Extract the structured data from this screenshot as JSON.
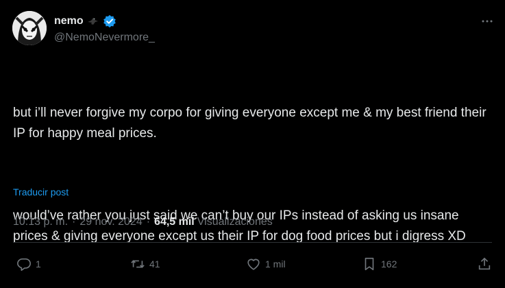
{
  "author": {
    "display_name": "nemo",
    "handle": "@NemoNevermore_",
    "emoji_icon": "crow-icon",
    "verified_icon": "verified-badge-icon"
  },
  "tweet": {
    "paragraphs": [
      "but i’ll never forgive my corpo for giving everyone except me & my best friend their IP for happy meal prices.",
      "would’ve rather you just said we can’t buy our IPs instead of asking us insane prices & giving everyone except us their IP for dog food prices but i digress XD"
    ],
    "translate_label": "Traducir post"
  },
  "meta": {
    "time": "10:13 p. m.",
    "separator": "·",
    "date": "29 nov. 2024",
    "views_count": "64,5 mil",
    "views_label": "Visualizaciones"
  },
  "actions": {
    "replies": "1",
    "reposts": "41",
    "likes": "1 mil",
    "bookmarks": "162"
  },
  "colors": {
    "background": "#000000",
    "text": "#e7e9ea",
    "secondary": "#71767b",
    "accent": "#1d9bf0"
  }
}
